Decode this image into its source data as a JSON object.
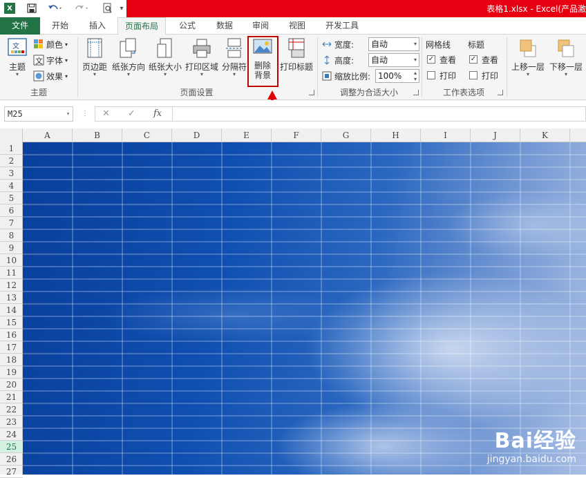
{
  "window": {
    "title": "表格1.xlsx - Excel(产品激",
    "app_icon": "X"
  },
  "tabs": [
    "文件",
    "开始",
    "插入",
    "页面布局",
    "公式",
    "数据",
    "审阅",
    "视图",
    "开发工具"
  ],
  "ribbon": {
    "theme_group": {
      "label": "主题",
      "theme_btn": "主题",
      "colors": "颜色",
      "fonts": "字体",
      "effects": "效果"
    },
    "page_setup": {
      "label": "页面设置",
      "margins": "页边距",
      "orientation": "纸张方向",
      "size": "纸张大小",
      "print_area": "打印区域",
      "breaks": "分隔符",
      "delete_bg_line1": "删除",
      "delete_bg_line2": "背景",
      "print_titles": "打印标题"
    },
    "scale_fit": {
      "label": "调整为合适大小",
      "width_label": "宽度:",
      "width_value": "自动",
      "height_label": "高度:",
      "height_value": "自动",
      "scale_label": "缩放比例:",
      "scale_value": "100%"
    },
    "sheet_options": {
      "label": "工作表选项",
      "gridlines": "网格线",
      "headings": "标题",
      "view": "查看",
      "print": "打印"
    },
    "arrange": {
      "bring_forward": "上移一层",
      "send_backward": "下移一层"
    }
  },
  "formula_bar": {
    "name_box": "M25",
    "fx": "fx",
    "value": ""
  },
  "columns": [
    "A",
    "B",
    "C",
    "D",
    "E",
    "F",
    "G",
    "H",
    "I",
    "J",
    "K"
  ],
  "rows": [
    "1",
    "2",
    "3",
    "4",
    "5",
    "6",
    "7",
    "8",
    "9",
    "10",
    "11",
    "12",
    "13",
    "14",
    "15",
    "16",
    "17",
    "18",
    "19",
    "20",
    "21",
    "22",
    "23",
    "24",
    "25",
    "26",
    "27"
  ],
  "selected_row": "25",
  "watermark": {
    "brand": "Bai经验",
    "url": "jingyan.baidu.com"
  },
  "colors": {
    "excel_green": "#217346",
    "title_red": "#e60012",
    "highlight": "#c00000"
  }
}
